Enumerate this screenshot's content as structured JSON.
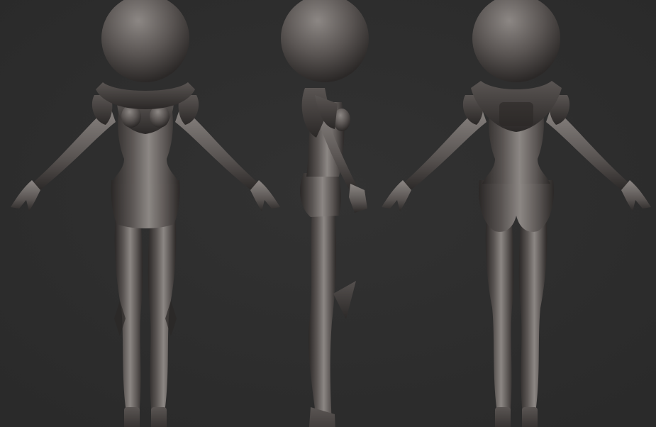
{
  "scene": {
    "background": "#323232",
    "vignette": "#2a2a2a",
    "material_light": "#8c8784",
    "material_mid": "#5a5553",
    "material_dark": "#2b2827",
    "views": [
      {
        "name": "front"
      },
      {
        "name": "side"
      },
      {
        "name": "back"
      }
    ]
  }
}
